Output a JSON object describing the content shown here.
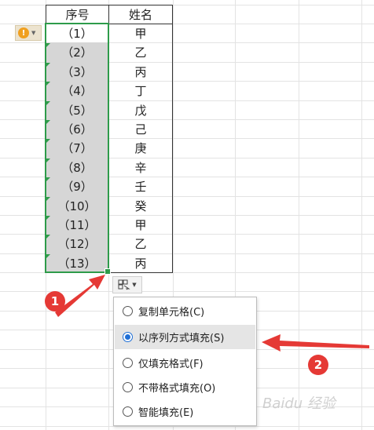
{
  "table": {
    "header": {
      "seq": "序号",
      "name": "姓名"
    },
    "rows": [
      {
        "seq": "（1）",
        "name": "甲"
      },
      {
        "seq": "（2）",
        "name": "乙"
      },
      {
        "seq": "（3）",
        "name": "丙"
      },
      {
        "seq": "（4）",
        "name": "丁"
      },
      {
        "seq": "（5）",
        "name": "戊"
      },
      {
        "seq": "（6）",
        "name": "己"
      },
      {
        "seq": "（7）",
        "name": "庚"
      },
      {
        "seq": "（8）",
        "name": "辛"
      },
      {
        "seq": "（9）",
        "name": "壬"
      },
      {
        "seq": "（10）",
        "name": "癸"
      },
      {
        "seq": "（11）",
        "name": "甲"
      },
      {
        "seq": "（12）",
        "name": "乙"
      },
      {
        "seq": "（13）",
        "name": "丙"
      }
    ]
  },
  "warning_icon": "exclamation-icon",
  "autofill_icon": "autofill-options-icon",
  "menu": {
    "items": [
      {
        "label": "复制单元格(C)",
        "selected": false
      },
      {
        "label": "以序列方式填充(S)",
        "selected": true
      },
      {
        "label": "仅填充格式(F)",
        "selected": false
      },
      {
        "label": "不带格式填充(O)",
        "selected": false
      },
      {
        "label": "智能填充(E)",
        "selected": false
      }
    ]
  },
  "annotations": {
    "badge1": "1",
    "badge2": "2",
    "accent_color": "#e53935"
  },
  "watermark": "Baidu 经验"
}
